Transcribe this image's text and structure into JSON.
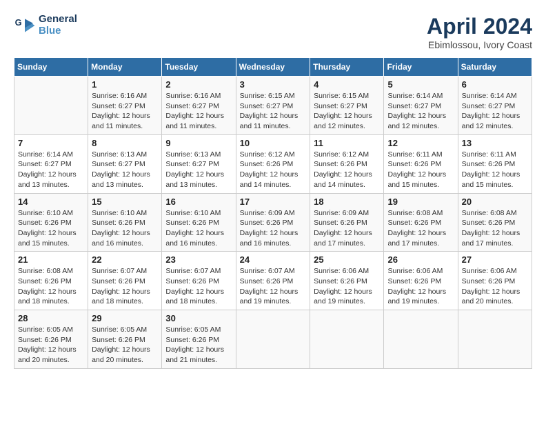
{
  "header": {
    "logo_line1": "General",
    "logo_line2": "Blue",
    "month": "April 2024",
    "location": "Ebimlossou, Ivory Coast"
  },
  "days_of_week": [
    "Sunday",
    "Monday",
    "Tuesday",
    "Wednesday",
    "Thursday",
    "Friday",
    "Saturday"
  ],
  "weeks": [
    [
      {
        "day": "",
        "info": ""
      },
      {
        "day": "1",
        "info": "Sunrise: 6:16 AM\nSunset: 6:27 PM\nDaylight: 12 hours\nand 11 minutes."
      },
      {
        "day": "2",
        "info": "Sunrise: 6:16 AM\nSunset: 6:27 PM\nDaylight: 12 hours\nand 11 minutes."
      },
      {
        "day": "3",
        "info": "Sunrise: 6:15 AM\nSunset: 6:27 PM\nDaylight: 12 hours\nand 11 minutes."
      },
      {
        "day": "4",
        "info": "Sunrise: 6:15 AM\nSunset: 6:27 PM\nDaylight: 12 hours\nand 12 minutes."
      },
      {
        "day": "5",
        "info": "Sunrise: 6:14 AM\nSunset: 6:27 PM\nDaylight: 12 hours\nand 12 minutes."
      },
      {
        "day": "6",
        "info": "Sunrise: 6:14 AM\nSunset: 6:27 PM\nDaylight: 12 hours\nand 12 minutes."
      }
    ],
    [
      {
        "day": "7",
        "info": "Sunrise: 6:14 AM\nSunset: 6:27 PM\nDaylight: 12 hours\nand 13 minutes."
      },
      {
        "day": "8",
        "info": "Sunrise: 6:13 AM\nSunset: 6:27 PM\nDaylight: 12 hours\nand 13 minutes."
      },
      {
        "day": "9",
        "info": "Sunrise: 6:13 AM\nSunset: 6:27 PM\nDaylight: 12 hours\nand 13 minutes."
      },
      {
        "day": "10",
        "info": "Sunrise: 6:12 AM\nSunset: 6:26 PM\nDaylight: 12 hours\nand 14 minutes."
      },
      {
        "day": "11",
        "info": "Sunrise: 6:12 AM\nSunset: 6:26 PM\nDaylight: 12 hours\nand 14 minutes."
      },
      {
        "day": "12",
        "info": "Sunrise: 6:11 AM\nSunset: 6:26 PM\nDaylight: 12 hours\nand 15 minutes."
      },
      {
        "day": "13",
        "info": "Sunrise: 6:11 AM\nSunset: 6:26 PM\nDaylight: 12 hours\nand 15 minutes."
      }
    ],
    [
      {
        "day": "14",
        "info": "Sunrise: 6:10 AM\nSunset: 6:26 PM\nDaylight: 12 hours\nand 15 minutes."
      },
      {
        "day": "15",
        "info": "Sunrise: 6:10 AM\nSunset: 6:26 PM\nDaylight: 12 hours\nand 16 minutes."
      },
      {
        "day": "16",
        "info": "Sunrise: 6:10 AM\nSunset: 6:26 PM\nDaylight: 12 hours\nand 16 minutes."
      },
      {
        "day": "17",
        "info": "Sunrise: 6:09 AM\nSunset: 6:26 PM\nDaylight: 12 hours\nand 16 minutes."
      },
      {
        "day": "18",
        "info": "Sunrise: 6:09 AM\nSunset: 6:26 PM\nDaylight: 12 hours\nand 17 minutes."
      },
      {
        "day": "19",
        "info": "Sunrise: 6:08 AM\nSunset: 6:26 PM\nDaylight: 12 hours\nand 17 minutes."
      },
      {
        "day": "20",
        "info": "Sunrise: 6:08 AM\nSunset: 6:26 PM\nDaylight: 12 hours\nand 17 minutes."
      }
    ],
    [
      {
        "day": "21",
        "info": "Sunrise: 6:08 AM\nSunset: 6:26 PM\nDaylight: 12 hours\nand 18 minutes."
      },
      {
        "day": "22",
        "info": "Sunrise: 6:07 AM\nSunset: 6:26 PM\nDaylight: 12 hours\nand 18 minutes."
      },
      {
        "day": "23",
        "info": "Sunrise: 6:07 AM\nSunset: 6:26 PM\nDaylight: 12 hours\nand 18 minutes."
      },
      {
        "day": "24",
        "info": "Sunrise: 6:07 AM\nSunset: 6:26 PM\nDaylight: 12 hours\nand 19 minutes."
      },
      {
        "day": "25",
        "info": "Sunrise: 6:06 AM\nSunset: 6:26 PM\nDaylight: 12 hours\nand 19 minutes."
      },
      {
        "day": "26",
        "info": "Sunrise: 6:06 AM\nSunset: 6:26 PM\nDaylight: 12 hours\nand 19 minutes."
      },
      {
        "day": "27",
        "info": "Sunrise: 6:06 AM\nSunset: 6:26 PM\nDaylight: 12 hours\nand 20 minutes."
      }
    ],
    [
      {
        "day": "28",
        "info": "Sunrise: 6:05 AM\nSunset: 6:26 PM\nDaylight: 12 hours\nand 20 minutes."
      },
      {
        "day": "29",
        "info": "Sunrise: 6:05 AM\nSunset: 6:26 PM\nDaylight: 12 hours\nand 20 minutes."
      },
      {
        "day": "30",
        "info": "Sunrise: 6:05 AM\nSunset: 6:26 PM\nDaylight: 12 hours\nand 21 minutes."
      },
      {
        "day": "",
        "info": ""
      },
      {
        "day": "",
        "info": ""
      },
      {
        "day": "",
        "info": ""
      },
      {
        "day": "",
        "info": ""
      }
    ]
  ]
}
